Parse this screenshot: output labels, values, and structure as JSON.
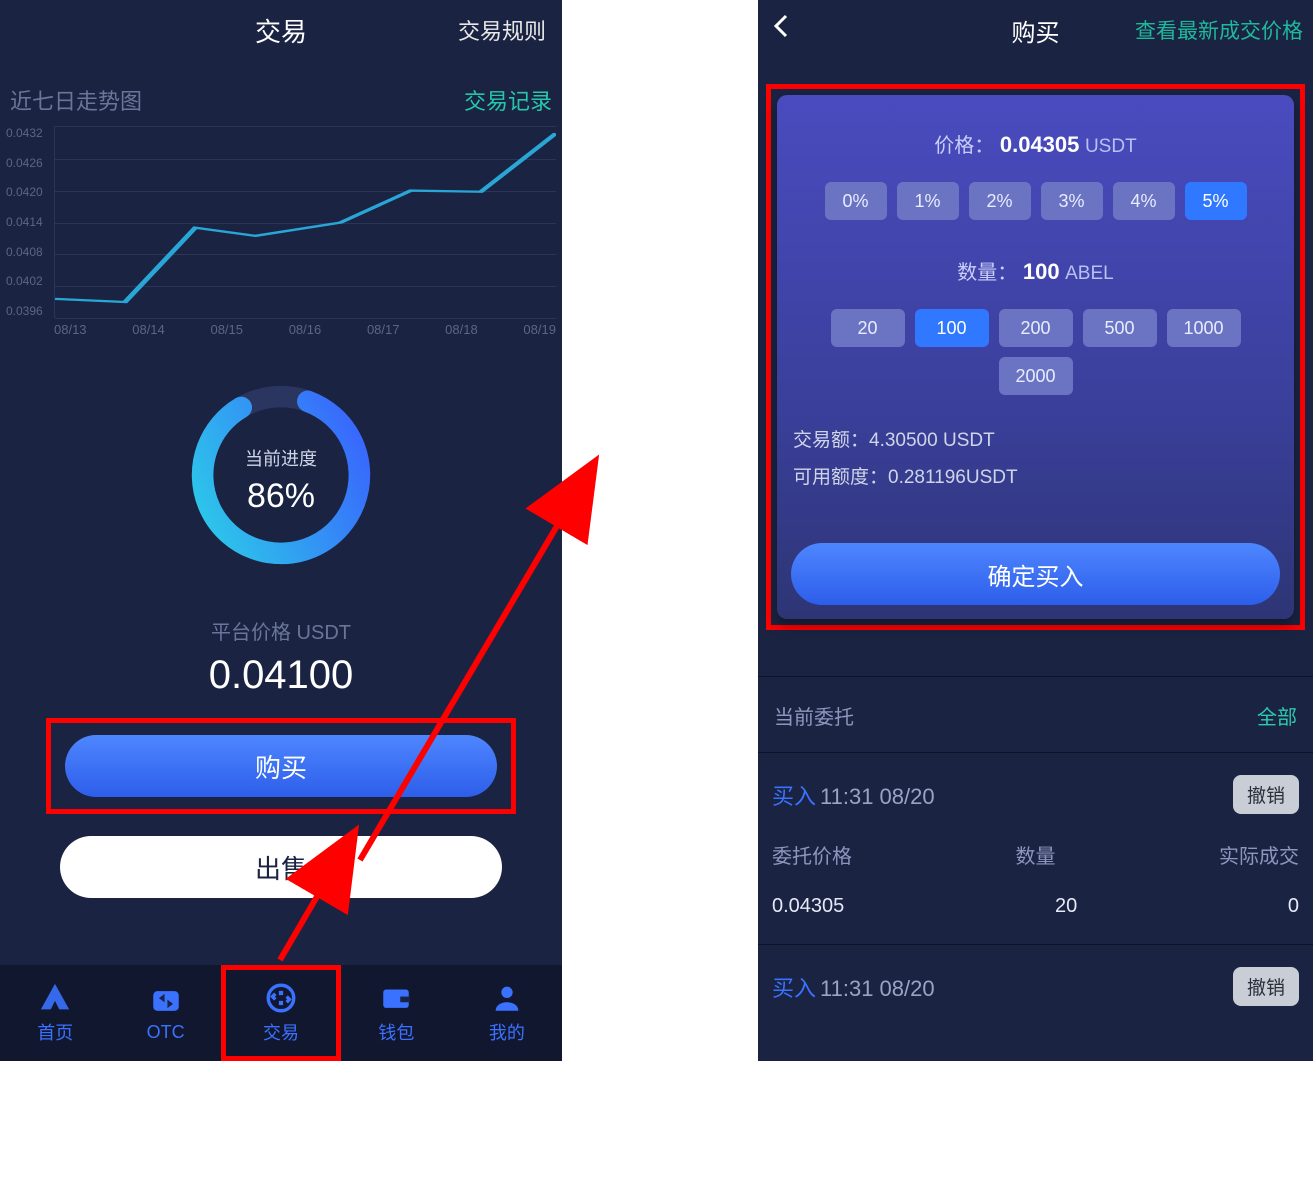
{
  "left": {
    "header": {
      "title": "交易",
      "rules": "交易规则"
    },
    "subrow": {
      "label": "近七日走势图",
      "records": "交易记录"
    },
    "donut": {
      "top_label": "当前进度",
      "value": "86%"
    },
    "price_label": "平台价格 USDT",
    "price_value": "0.04100",
    "buy_label": "购买",
    "sell_label": "出售",
    "nav": {
      "home": "首页",
      "otc": "OTC",
      "trade": "交易",
      "wallet": "钱包",
      "mine": "我的"
    }
  },
  "right": {
    "header": {
      "title": "购买",
      "latest": "查看最新成交价格"
    },
    "panel": {
      "price_label": "价格：",
      "price_value": "0.04305",
      "price_unit": "USDT",
      "pct": [
        "0%",
        "1%",
        "2%",
        "3%",
        "4%",
        "5%"
      ],
      "pct_selected": 5,
      "qty_label": "数量：",
      "qty_value": "100",
      "qty_unit": "ABEL",
      "qty_opts": [
        "20",
        "100",
        "200",
        "500",
        "1000",
        "2000"
      ],
      "qty_selected": 1,
      "amount_label": "交易额：",
      "amount_value": "4.30500 USDT",
      "avail_label": "可用额度：",
      "avail_value": "0.281196USDT",
      "confirm": "确定买入"
    },
    "orders_header": {
      "label": "当前委托",
      "all": "全部"
    },
    "orders": [
      {
        "side": "买入",
        "ts": "11:31 08/20",
        "cancel": "撤销",
        "col1": "委托价格",
        "col2": "数量",
        "col3": "实际成交",
        "v1": "0.04305",
        "v2": "20",
        "v3": "0"
      },
      {
        "side": "买入",
        "ts": "11:31 08/20",
        "cancel": "撤销"
      }
    ]
  },
  "chart_data": {
    "type": "line",
    "title": "近七日走势图",
    "x": [
      "08/13",
      "08/14",
      "08/15",
      "08/16",
      "08/17",
      "08/18",
      "08/19"
    ],
    "y": [
      0.03996,
      0.0399,
      0.0413,
      0.04115,
      0.0414,
      0.042,
      0.04198,
      0.04308
    ],
    "ytick_labels": [
      "0.0432",
      "0.0426",
      "0.0420",
      "0.0414",
      "0.0408",
      "0.0402",
      "0.0396"
    ],
    "ylim": [
      0.0396,
      0.0432
    ],
    "ylabel": "",
    "xlabel": ""
  }
}
